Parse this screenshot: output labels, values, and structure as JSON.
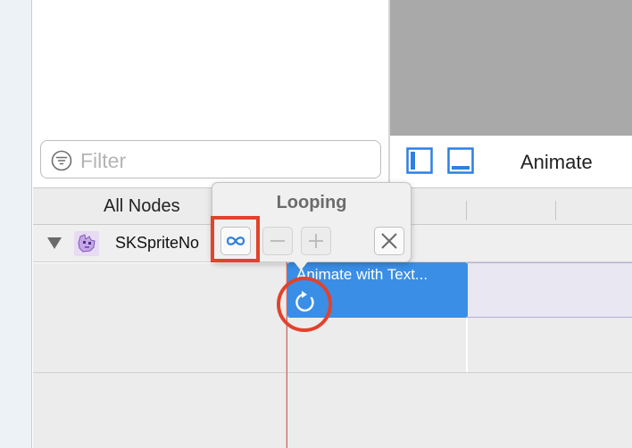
{
  "navigator": {
    "filter_placeholder": "Filter",
    "filter_icon": "filter-circle-icon"
  },
  "preview_toolbar": {
    "label": "Animate",
    "buttons": [
      {
        "icon": "left-panel-layout-icon"
      },
      {
        "icon": "bottom-panel-layout-icon"
      }
    ]
  },
  "timeline": {
    "column_header": "All Nodes",
    "node": {
      "name": "SKSpriteNo",
      "icon": "sprite-node-icon",
      "expanded": true
    },
    "action": {
      "label": "Animate with Text...",
      "loop_icon": "loop-arrow-icon",
      "color": "#3a8ee6"
    }
  },
  "popover": {
    "title": "Looping",
    "buttons": [
      {
        "icon": "infinity-icon",
        "selected": true
      },
      {
        "icon": "minus-icon",
        "enabled": false
      },
      {
        "icon": "plus-icon",
        "enabled": false
      },
      {
        "icon": "close-x-icon",
        "enabled": true
      }
    ]
  },
  "annotations": {
    "color": "#e1432c"
  }
}
